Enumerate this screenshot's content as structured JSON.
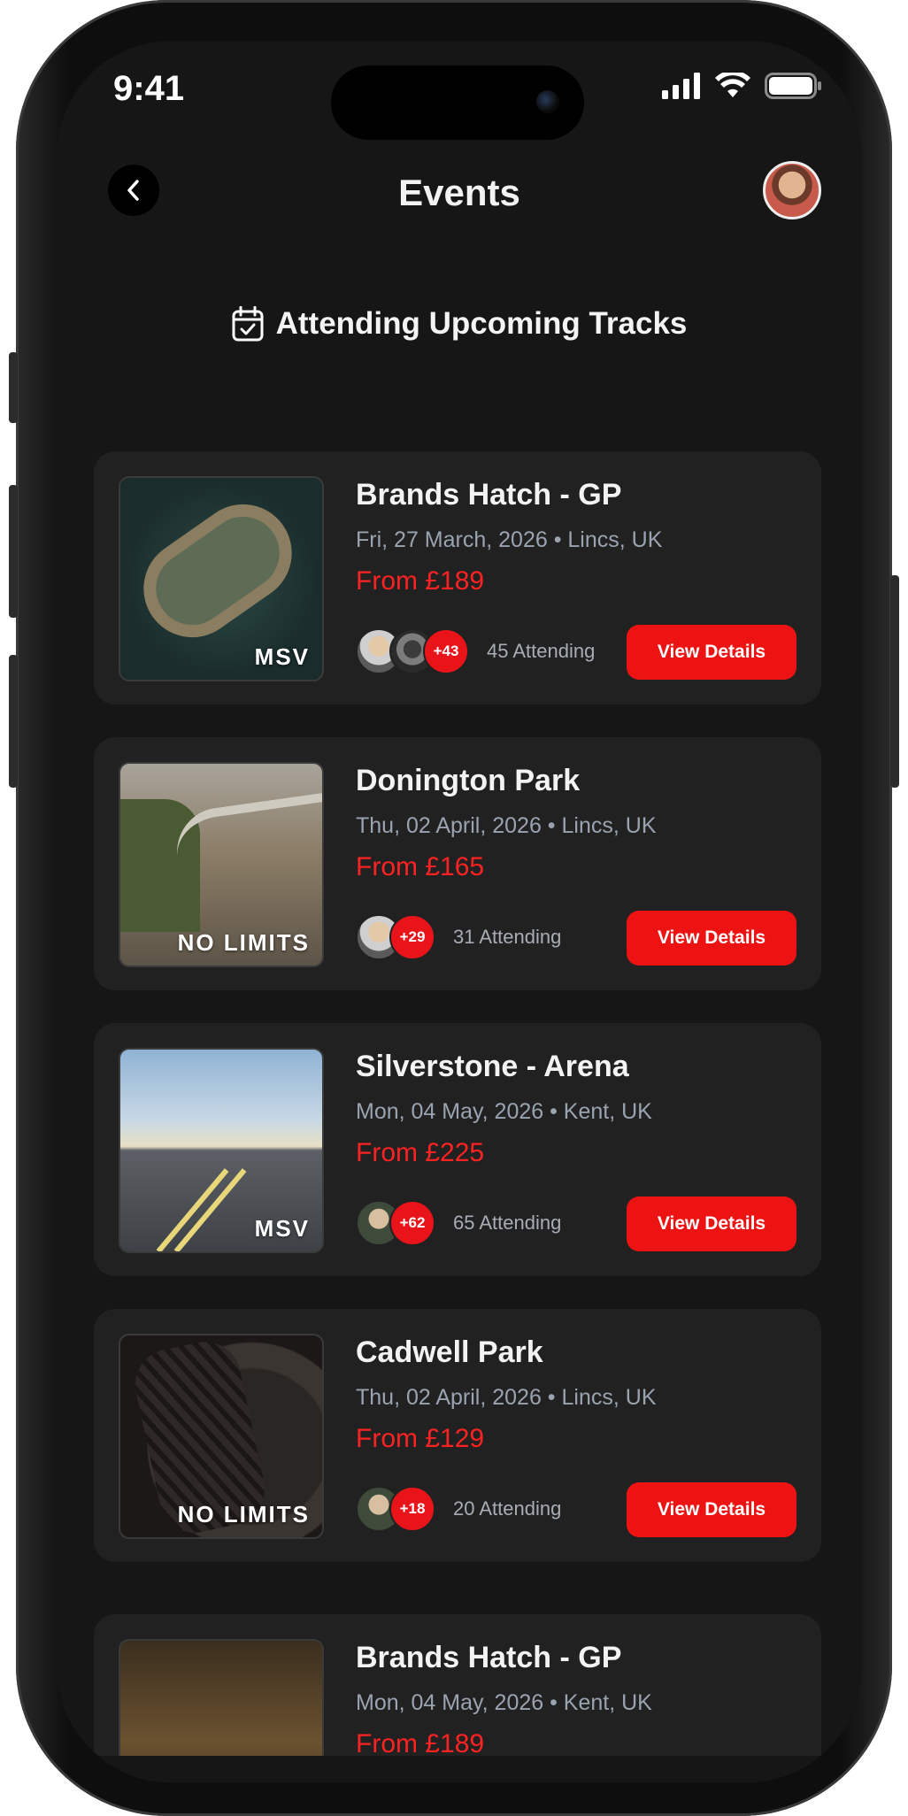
{
  "status_bar": {
    "time": "9:41"
  },
  "header": {
    "title": "Events"
  },
  "section": {
    "title": "Attending Upcoming Tracks"
  },
  "colors": {
    "accent": "#ee1313",
    "price": "#ff2222",
    "card_bg": "#212121",
    "screen_bg": "#161616"
  },
  "events": [
    {
      "title": "Brands Hatch - GP",
      "subtitle": "Fri, 27 March, 2026 • Lincs, UK",
      "price": "From £189",
      "thumb_label": "MSV",
      "thumb_icon": "aerial-track-image",
      "extra": "+43",
      "attending": "45 Attending",
      "button": "View Details"
    },
    {
      "title": "Donington Park",
      "subtitle": "Thu, 02 April, 2026 • Lincs, UK",
      "price": "From £165",
      "thumb_label": "NO LIMITS",
      "thumb_icon": "overpass-road-image",
      "extra": "+29",
      "attending": "31 Attending",
      "button": "View Details"
    },
    {
      "title": "Silverstone - Arena",
      "subtitle": "Mon, 04 May, 2026 • Kent, UK",
      "price": "From £225",
      "thumb_label": "MSV",
      "thumb_icon": "open-road-image",
      "extra": "+62",
      "attending": "65 Attending",
      "button": "View Details"
    },
    {
      "title": "Cadwell Park",
      "subtitle": "Thu, 02 April, 2026 • Lincs, UK",
      "price": "From £129",
      "thumb_label": "NO LIMITS",
      "thumb_icon": "tire-image",
      "extra": "+18",
      "attending": "20 Attending",
      "button": "View Details"
    },
    {
      "title": "Brands Hatch - GP",
      "subtitle": "Mon, 04 May, 2026 • Kent, UK",
      "price": "From £189",
      "thumb_label": "",
      "thumb_icon": "night-tunnel-image"
    }
  ]
}
